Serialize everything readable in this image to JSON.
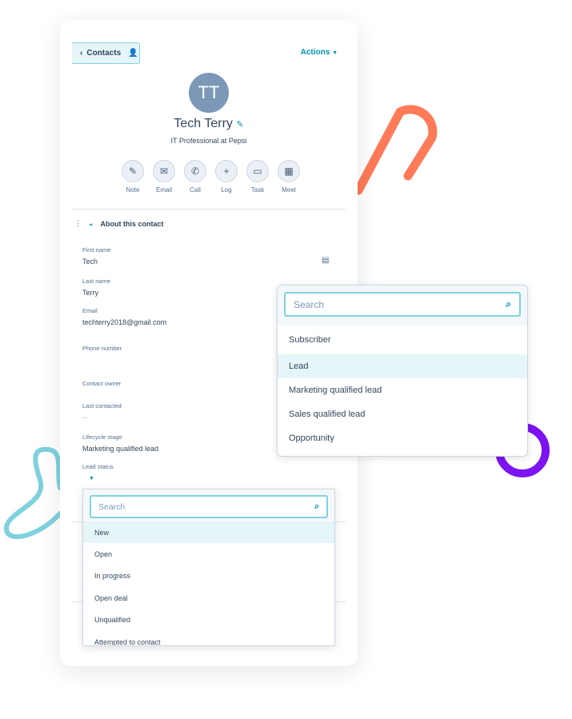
{
  "colors": {
    "accent": "#0091ae",
    "orange": "#ff7a59",
    "purple": "#7c13f0",
    "teal": "#7fd1de"
  },
  "header": {
    "back_label": "Contacts",
    "actions_label": "Actions"
  },
  "contact": {
    "initials": "TT",
    "name": "Tech Terry",
    "title": "IT Professional at Pepsi"
  },
  "activity_buttons": [
    {
      "label": "Note",
      "icon": "note-icon"
    },
    {
      "label": "Email",
      "icon": "email-icon"
    },
    {
      "label": "Call",
      "icon": "phone-icon"
    },
    {
      "label": "Log",
      "icon": "plus-icon"
    },
    {
      "label": "Task",
      "icon": "task-icon"
    },
    {
      "label": "Meet",
      "icon": "calendar-icon"
    }
  ],
  "section": {
    "title": "About this contact"
  },
  "fields": [
    {
      "label": "First name",
      "value": "Tech"
    },
    {
      "label": "Last name",
      "value": "Terry"
    },
    {
      "label": "Email",
      "value": "techterry2018@gmail.com"
    },
    {
      "label": "Phone number",
      "value": ""
    },
    {
      "label": "Contact owner",
      "value": ""
    },
    {
      "label": "Last contacted",
      "value": "--"
    },
    {
      "label": "Lifecycle stage",
      "value": "Marketing qualified lead"
    },
    {
      "label": "Lead status",
      "value": ""
    }
  ],
  "lead_status_dropdown": {
    "placeholder": "Search",
    "options": [
      "New",
      "Open",
      "In progress",
      "Open deal",
      "Unqualified",
      "Attempted to contact"
    ],
    "highlighted": "New"
  },
  "lifecycle_dropdown": {
    "placeholder": "Search",
    "options": [
      "Subscriber",
      "Lead",
      "Marketing qualified lead",
      "Sales qualified lead",
      "Opportunity"
    ],
    "highlighted": "Lead"
  }
}
